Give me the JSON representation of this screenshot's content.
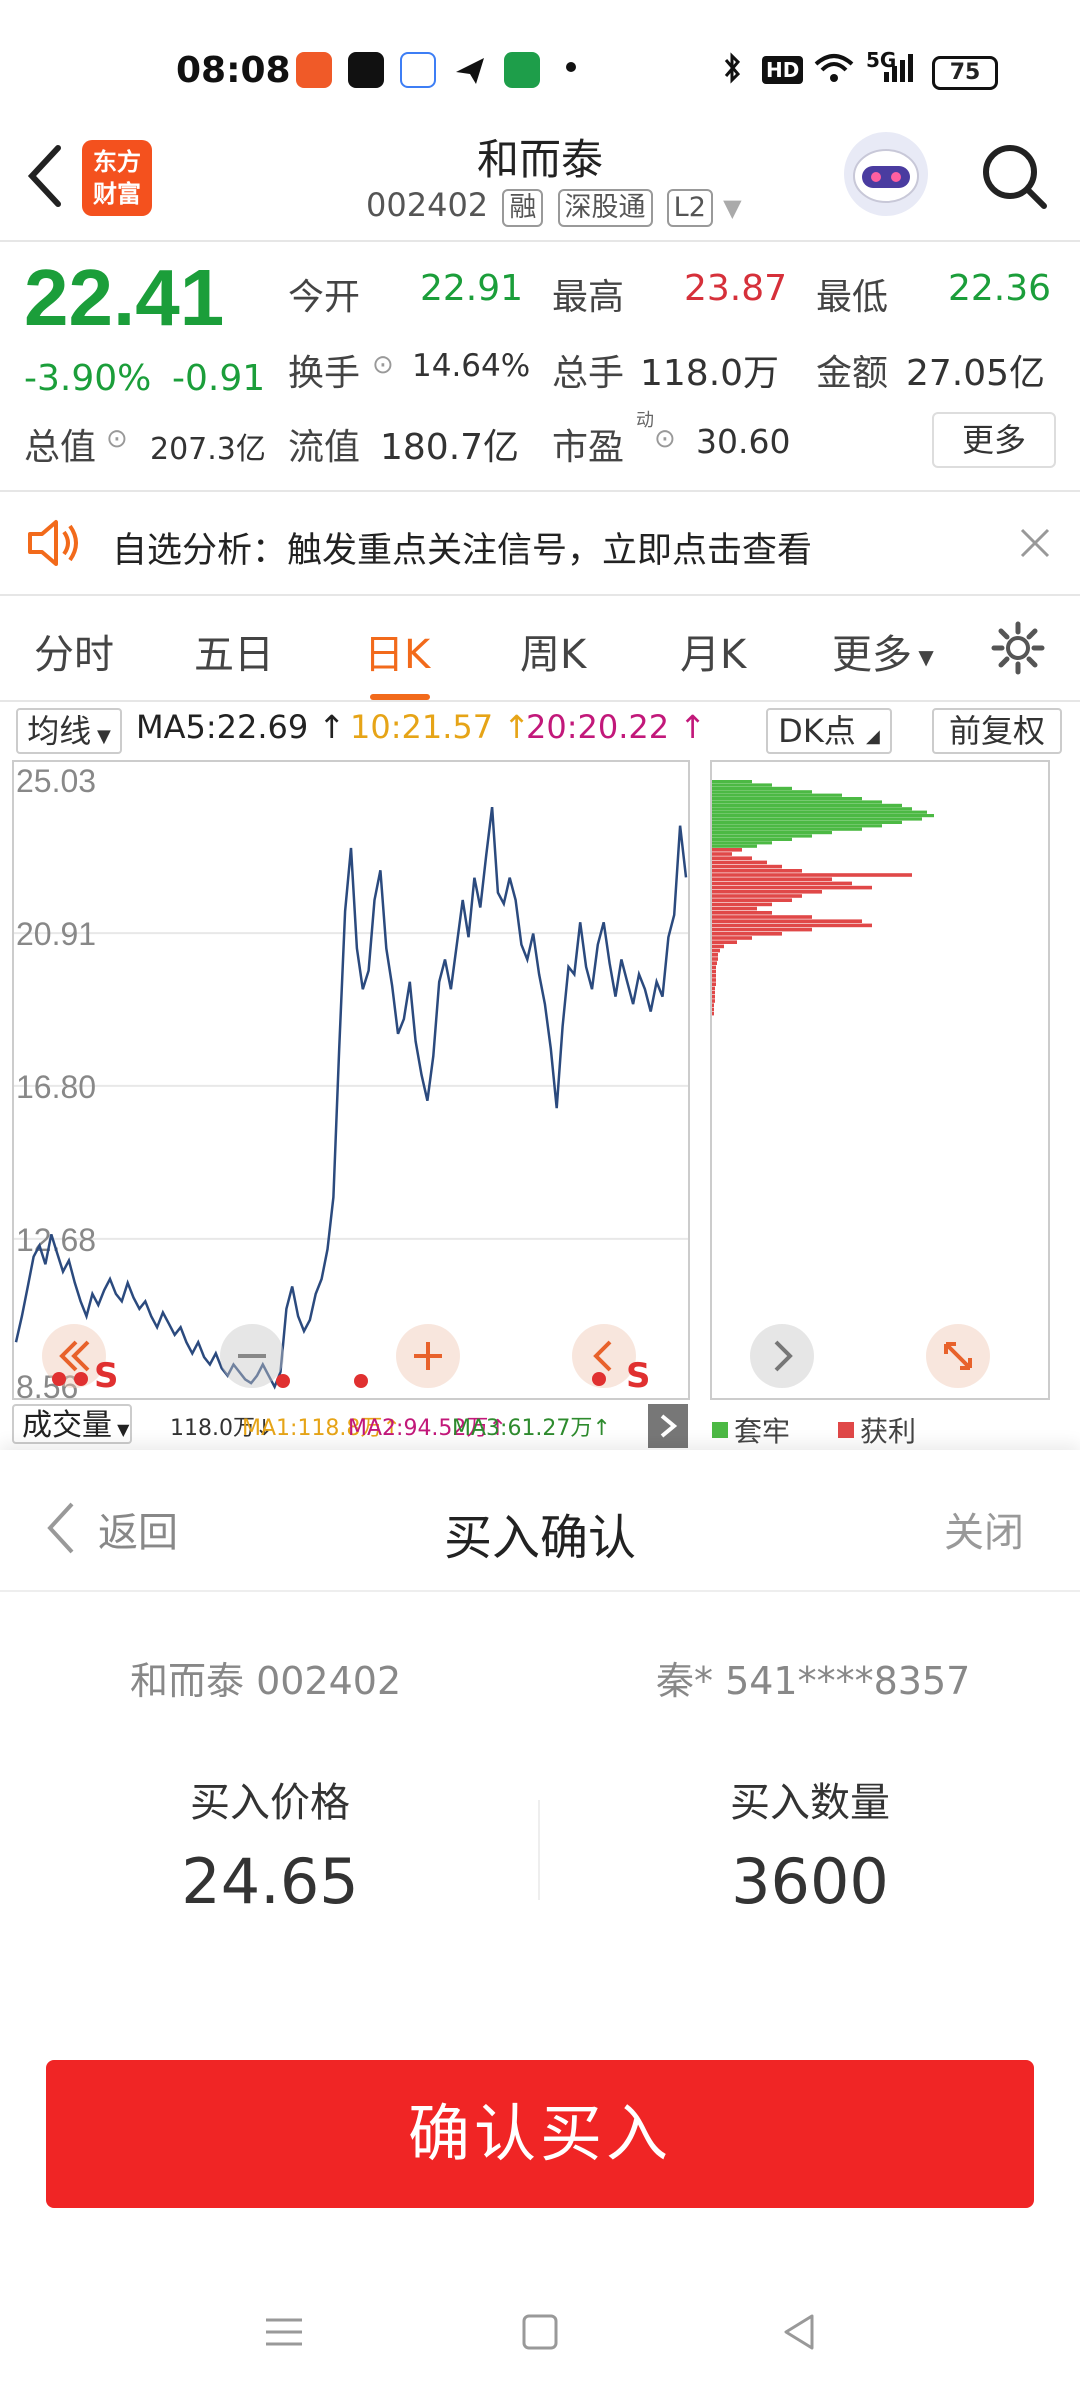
{
  "status_bar": {
    "time": "08:08",
    "hd": "HD",
    "network": "5G",
    "battery": "75"
  },
  "header": {
    "logo_text": "东方财富",
    "stock_name": "和而泰",
    "stock_code": "002402",
    "tags": [
      "融",
      "深股通",
      "L2"
    ]
  },
  "quote": {
    "price": "22.41",
    "change_pct": "-3.90%",
    "change": "-0.91",
    "open_label": "今开",
    "open": "22.91",
    "high_label": "最高",
    "high": "23.87",
    "low_label": "最低",
    "low": "22.36",
    "turnover_label": "换手",
    "turnover": "14.64%",
    "volume_label": "总手",
    "volume": "118.0万",
    "amount_label": "金额",
    "amount": "27.05亿",
    "mktcap_label": "总值",
    "mktcap": "207.3亿",
    "float_label": "流值",
    "float": "180.7亿",
    "pe_label": "市盈",
    "pe_sup": "动",
    "pe": "30.60",
    "more": "更多"
  },
  "alert": {
    "text": "自选分析：触发重点关注信号，立即点击查看"
  },
  "tabs": [
    "分时",
    "五日",
    "日K",
    "周K",
    "月K",
    "更多"
  ],
  "active_tab": "日K",
  "indicators": {
    "ma_label": "均线",
    "ma5": "MA5:22.69",
    "ma10": "10:21.57",
    "ma20": "20:20.22",
    "dk": "DK点",
    "adjust": "前复权"
  },
  "chart_data": {
    "type": "line",
    "y_ticks": [
      "25.03",
      "20.91",
      "16.80",
      "12.68",
      "8.56"
    ],
    "ylim": [
      8.56,
      25.03
    ],
    "y": [
      9.9,
      10.6,
      11.4,
      12.2,
      12.5,
      12.0,
      12.8,
      12.3,
      11.8,
      12.1,
      11.5,
      11.0,
      10.6,
      11.2,
      10.9,
      11.3,
      11.6,
      11.2,
      11.0,
      11.5,
      11.1,
      10.8,
      11.0,
      10.6,
      10.3,
      10.7,
      10.4,
      10.1,
      10.3,
      9.9,
      9.6,
      9.9,
      9.5,
      9.3,
      9.6,
      9.2,
      9.0,
      9.3,
      9.1,
      8.9,
      8.8,
      9.0,
      9.3,
      9.0,
      8.7,
      9.1,
      10.8,
      11.4,
      10.6,
      10.2,
      10.5,
      11.2,
      11.6,
      12.4,
      13.8,
      17.8,
      21.5,
      23.2,
      20.5,
      19.4,
      19.9,
      21.8,
      22.6,
      20.5,
      19.5,
      18.2,
      18.6,
      19.6,
      18.0,
      17.1,
      16.4,
      17.6,
      19.6,
      20.2,
      19.4,
      20.6,
      21.8,
      20.8,
      22.4,
      21.6,
      23.0,
      24.3,
      22.0,
      21.7,
      22.4,
      21.8,
      20.6,
      20.2,
      20.9,
      19.8,
      19.0,
      17.8,
      16.2,
      18.4,
      20.0,
      19.8,
      21.2,
      20.0,
      19.4,
      20.6,
      21.2,
      20.1,
      19.2,
      20.2,
      19.6,
      19.0,
      19.8,
      19.4,
      18.8,
      19.6,
      19.2,
      20.8,
      21.4,
      23.8,
      22.41
    ],
    "volume_profile": {
      "legend": [
        "套牢",
        "获利"
      ],
      "colors": [
        "#4cb944",
        "#e04848"
      ]
    }
  },
  "volume_row": {
    "label": "成交量",
    "v": "118.0万",
    "ma1": "MA1:118.8万",
    "ma2": "MA2:94.52万",
    "ma3": "MA3:61.27万"
  },
  "dialog": {
    "back": "返回",
    "title": "买入确认",
    "close": "关闭",
    "stock": "和而泰 002402",
    "account": "秦* 541****8357",
    "price_label": "买入价格",
    "price": "24.65",
    "qty_label": "买入数量",
    "qty": "3600",
    "confirm": "确认买入"
  }
}
